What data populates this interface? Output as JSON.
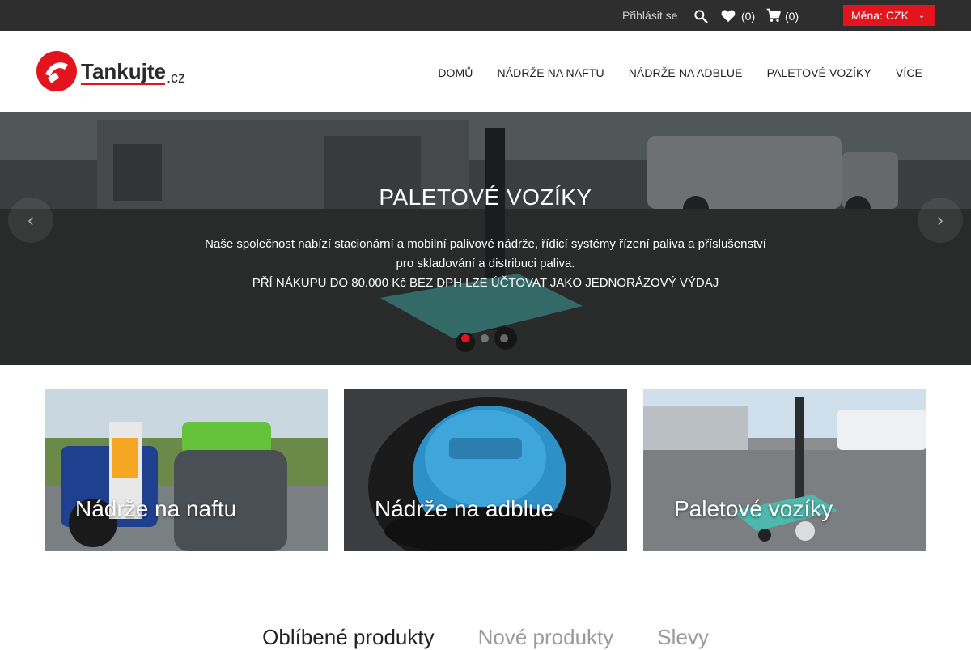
{
  "topbar": {
    "login_label": "Přihlásit se",
    "search_icon": "search-icon",
    "wishlist_count": "(0)",
    "cart_count": "(0)",
    "currency_label": "Měna:",
    "currency_value": "CZK"
  },
  "header": {
    "logo_main": "Tankujte",
    "logo_suffix": ".cz",
    "nav": [
      {
        "label": "DOMŮ"
      },
      {
        "label": "NÁDRŽE NA NAFTU"
      },
      {
        "label": "NÁDRŽE NA ADBLUE"
      },
      {
        "label": "PALETOVÉ VOZÍKY"
      },
      {
        "label": "VÍCE"
      }
    ]
  },
  "hero": {
    "title": "PALETOVÉ VOZÍKY",
    "line1": "Naše společnost nabízí stacionární a mobilní palivové nádrže, řídicí systémy řízení paliva a příslušenství",
    "line2": "pro skladování a distribuci paliva.",
    "line3": "PŘÍ NÁKUPU DO 80.000 Kč BEZ DPH LZE ÚČTOVAT JAKO JEDNORÁZOVÝ VÝDAJ",
    "prev": "‹",
    "next": "›",
    "slides_count": 3,
    "active_slide": 1
  },
  "tiles": [
    {
      "label": "Nádrže na naftu"
    },
    {
      "label": "Nádrže na adblue"
    },
    {
      "label": "Paletové vozíky"
    }
  ],
  "tabs": [
    {
      "label": "Oblíbené produkty",
      "active": true
    },
    {
      "label": "Nové produkty",
      "active": false
    },
    {
      "label": "Slevy",
      "active": false
    }
  ],
  "colors": {
    "accent": "#e3141d",
    "topbar_bg": "#2e2e2e"
  }
}
